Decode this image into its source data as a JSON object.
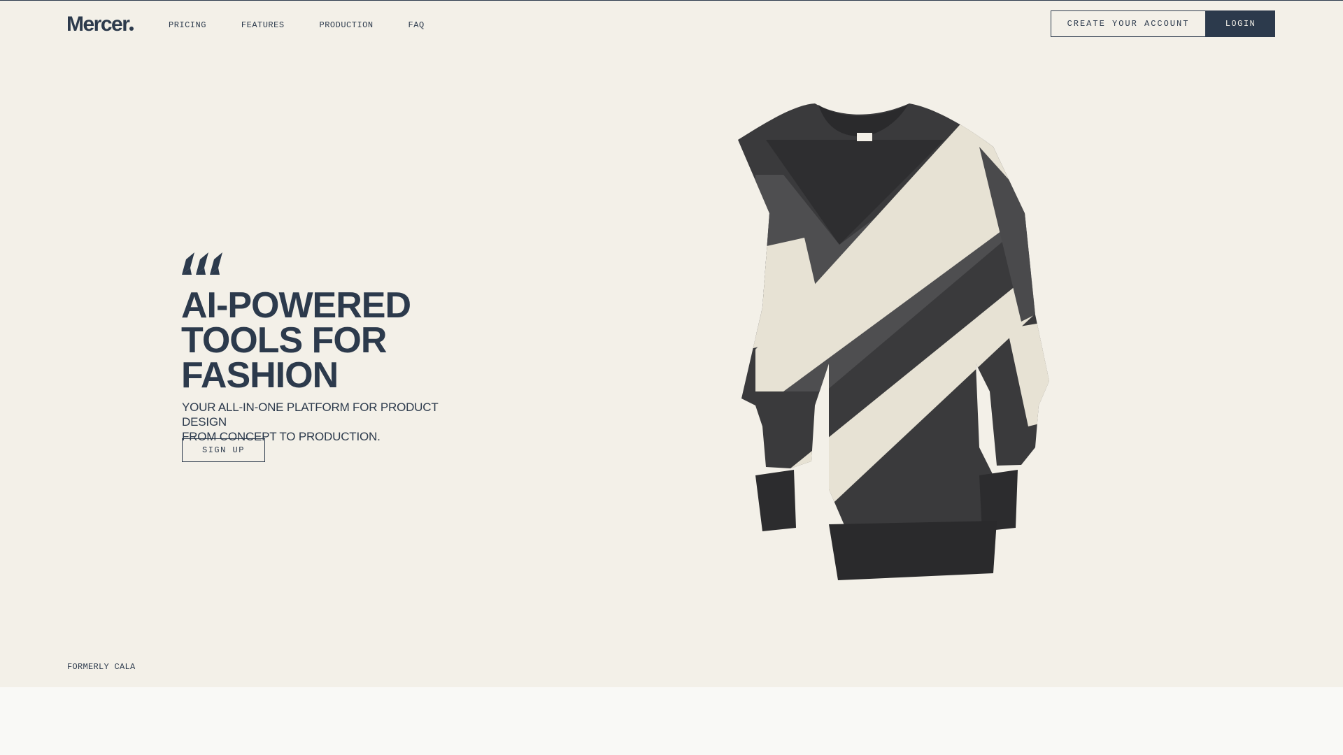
{
  "brand": {
    "name": "Mercer",
    "accent": "#2c3a4c",
    "background": "#f3f0e8"
  },
  "nav": {
    "links": [
      {
        "label": "PRICING"
      },
      {
        "label": "FEATURES"
      },
      {
        "label": "PRODUCTION"
      },
      {
        "label": "FAQ"
      }
    ],
    "create_account_label": "CREATE YOUR ACCOUNT",
    "login_label": "LOGIN"
  },
  "hero": {
    "mark_icon": "slanted-stripes-icon",
    "title_lines": [
      "AI-POWERED",
      "TOOLS FOR",
      "FASHION"
    ],
    "subtitle_lines": [
      "YOUR ALL-IN-ONE PLATFORM FOR PRODUCT DESIGN",
      "FROM CONCEPT TO PRODUCTION."
    ],
    "signup_label": "SIGN UP",
    "image_subject": "sweater-image"
  },
  "footer_note": "FORMERLY CALA"
}
